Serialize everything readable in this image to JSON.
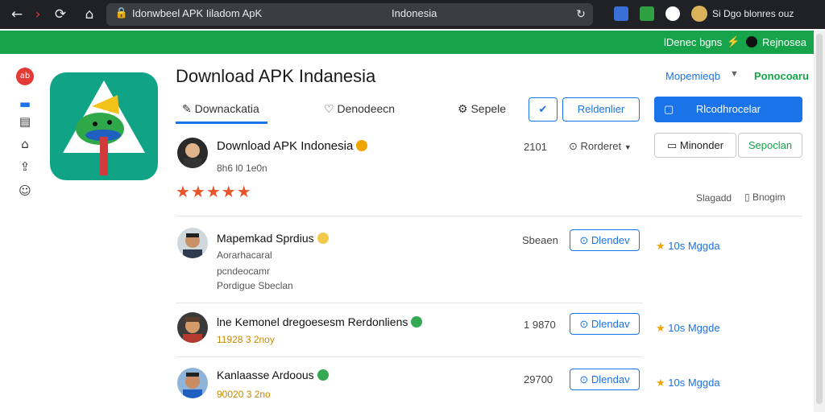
{
  "browser": {
    "url_text": "Idonwbeel APK Iiladom ApK",
    "tab_center": "Indonesia",
    "profile_text": "Si Dgo blonres ouz"
  },
  "green_bar": {
    "left_text": "lDenec bgns",
    "right_text": "Rejnosea"
  },
  "header": {
    "title": "Download APK Indanesia",
    "top_right_link": "Mopemieqb",
    "top_right_green": "Ponocoaru"
  },
  "tabs": [
    {
      "label": "Downackatia"
    },
    {
      "label": "Denodeecn"
    },
    {
      "label": "Sepele"
    }
  ],
  "actions": {
    "outline_label": "Reldenlier",
    "solid_label": "Rlcodhrocelar"
  },
  "featured": {
    "title": "Download APK Indonesia",
    "sub": "8h6  l0  1e0n",
    "count": "2101",
    "sort_label": "Rorderet",
    "btn_grey_label": "Minonder",
    "btn_green_label": "Sepoclan",
    "stars": "★★★★★",
    "stat_left": "Slagadd",
    "stat_right": "Bnogim"
  },
  "rows": [
    {
      "title": "Mapemkad Sprdius",
      "sub1": "Aorarhacaral",
      "sub2": "pcndeocamr",
      "sub3": "Pordigue Sbeclan",
      "count": "Sbeaen",
      "btn": "Dlendev",
      "rating": "10s Mggda"
    },
    {
      "title": "lne Kemonel dregoesesm Rerdonliens",
      "sub1": "11928 3 2noy",
      "count": "1 9870",
      "btn": "Dlendav",
      "rating": "10s Mggde"
    },
    {
      "title": "Kanlaasse Ardoous",
      "sub1": "90020 3 2no",
      "count": "29700",
      "btn": "Dlendav",
      "rating": "10s Mggda"
    }
  ],
  "colors": {
    "accent": "#1a73e8",
    "green": "#17a34a",
    "star": "#e8552b",
    "gold": "#f0a500"
  }
}
